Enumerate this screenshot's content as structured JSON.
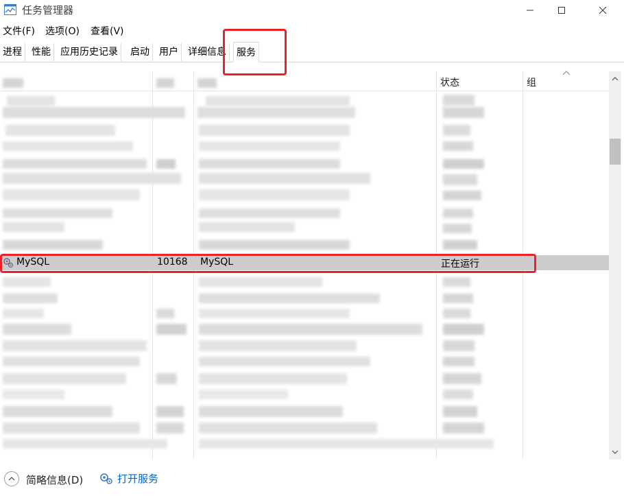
{
  "window": {
    "title": "任务管理器",
    "icon": "task-manager-icon"
  },
  "menu": [
    "文件(F)",
    "选项(O)",
    "查看(V)"
  ],
  "tabs": [
    "进程",
    "性能",
    "应用历史记录",
    "启动",
    "用户",
    "详细信息",
    "服务"
  ],
  "active_tab": "服务",
  "columns": {
    "status": "状态",
    "group": "组"
  },
  "selected_row": {
    "name": "MySQL",
    "pid": "10168",
    "description": "MySQL",
    "status": "正在运行",
    "group": ""
  },
  "footer": {
    "fewer_details": "简略信息(D)",
    "open_services": "打开服务"
  },
  "colors": {
    "highlight": "#e8242a",
    "selected_bg": "#cccccc",
    "link": "#0066cc"
  }
}
